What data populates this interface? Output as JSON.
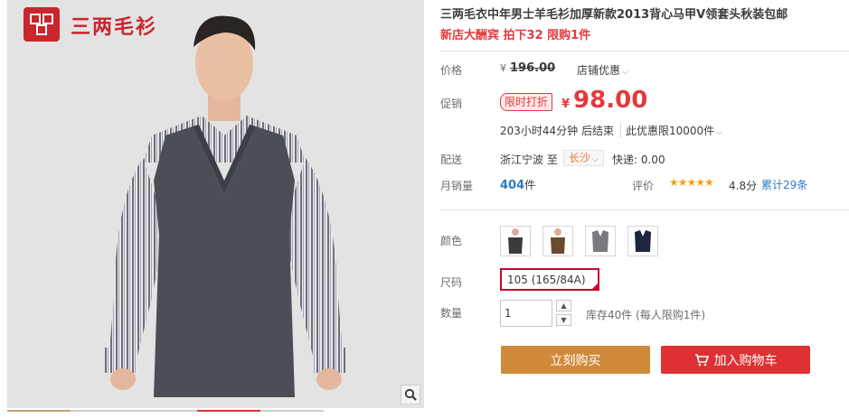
{
  "brand": {
    "name": "三两毛衫"
  },
  "product": {
    "title": "三两毛衣中年男士羊毛衫加厚新款2013背心马甲V领套头秋装包邮",
    "promo": "新店大酬宾 拍下32 限购1件"
  },
  "price": {
    "label": "价格",
    "currency": "¥",
    "original": "196.00",
    "store_discount": "店铺优惠"
  },
  "promotion": {
    "label": "促销",
    "badge": "限时打折",
    "currency": "¥",
    "sale_price": "98.00",
    "countdown": "203小时44分钟 后结束",
    "limit": "此优惠限10000件"
  },
  "shipping": {
    "label": "配送",
    "from": "浙江宁波",
    "to_word": "至",
    "to": "长沙",
    "express": "快递: 0.00"
  },
  "sales": {
    "label": "月销量",
    "count": "404",
    "unit": "件",
    "rating_label": "评价",
    "stars": "★★★★★",
    "score": "4.8分",
    "review_count": "累计29条"
  },
  "options": {
    "color_label": "颜色",
    "size_label": "尺码",
    "size_selected": "105 (165/84A)",
    "qty_label": "数量",
    "qty_value": "1",
    "stock": "库存40件 (每人限购1件)"
  },
  "actions": {
    "buy_now": "立刻购买",
    "add_cart": "加入购物车"
  },
  "colors": {
    "accent_red": "#e4393c",
    "buy_orange": "#d08a3a",
    "link_blue": "#2c7ac4"
  }
}
